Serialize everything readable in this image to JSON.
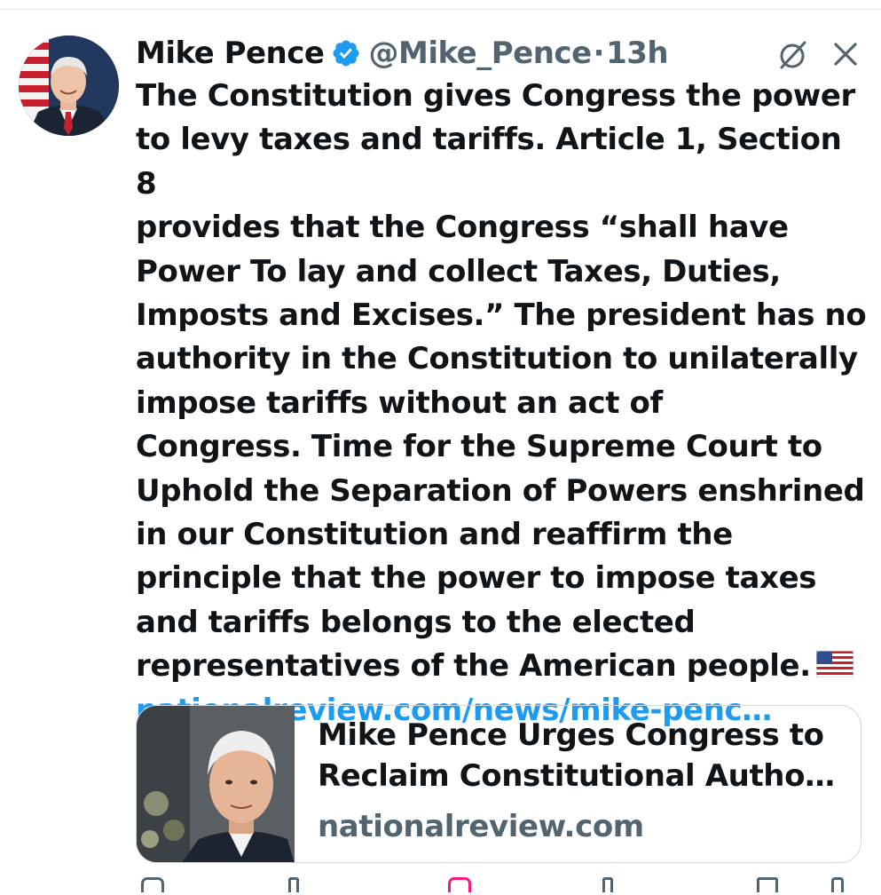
{
  "tweet": {
    "author_name": "Mike Pence",
    "handle": "@Mike_Pence",
    "separator": "·",
    "time": "13h",
    "verified": true,
    "body_lines": [
      "The Constitution gives Congress the power",
      "to levy taxes and tariffs. Article 1, Section 8",
      "provides that the Congress “shall have",
      "Power To lay and collect Taxes, Duties,",
      "Imposts and Excises.” The president has no",
      "authority in the Constitution to unilaterally",
      "impose tariffs without an act of",
      "Congress. Time for the Supreme Court to",
      "Uphold the Separation of Powers enshrined",
      "in our Constitution and reaffirm the",
      "principle that the power to impose taxes",
      "and tariffs belongs to the elected",
      "representatives of the American people."
    ],
    "emoji": "us-flag-emoji",
    "link_text": "nationalreview.com/news/mike-penc…"
  },
  "card": {
    "title_line_1": "Mike Pence Urges Congress to",
    "title_line_2": "Reclaim Constitutional Autho…",
    "domain": "nationalreview.com"
  },
  "icons": {
    "verified": "verified-badge-icon",
    "grok": "grok-icon",
    "close": "close-icon"
  },
  "colors": {
    "text": "#0f1419",
    "secondary": "#536471",
    "link": "#1d9bf0",
    "verified": "#1d9bf0",
    "border": "#cfd9de"
  }
}
